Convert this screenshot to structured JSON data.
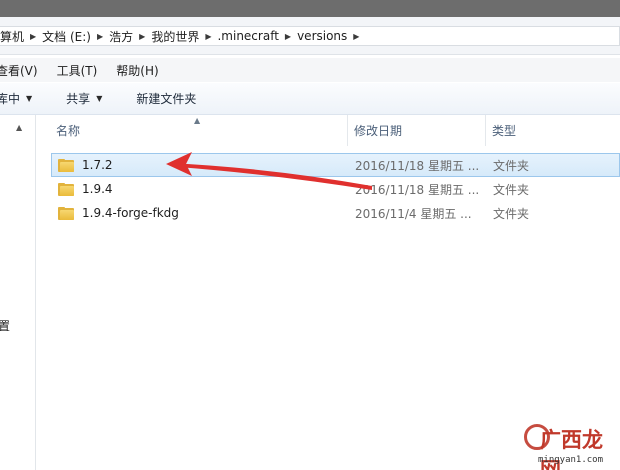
{
  "breadcrumb": {
    "items": [
      "算机",
      "文档 (E:)",
      "浩方",
      "我的世界",
      ".minecraft",
      "versions"
    ]
  },
  "menubar": {
    "items": [
      "查看(V)",
      "工具(T)",
      "帮助(H)"
    ]
  },
  "toolbar": {
    "include_label": "库中",
    "share_label": "共享",
    "new_folder_label": "新建文件夹"
  },
  "navpane": {
    "label": "置"
  },
  "columns": {
    "name": "名称",
    "date": "修改日期",
    "type": "类型"
  },
  "files": [
    {
      "name": "1.7.2",
      "date": "2016/11/18 星期五 ...",
      "type": "文件夹",
      "selected": true
    },
    {
      "name": "1.9.4",
      "date": "2016/11/18 星期五 ...",
      "type": "文件夹",
      "selected": false
    },
    {
      "name": "1.9.4-forge-fkdg",
      "date": "2016/11/4 星期五 ...",
      "type": "文件夹",
      "selected": false
    }
  ],
  "watermark": {
    "text": "广西龙网",
    "url": "mingyan1.com"
  },
  "colors": {
    "annotation_arrow": "#e0302e",
    "selection_fill": "#d9ebfa",
    "folder": "#eabb3b"
  }
}
